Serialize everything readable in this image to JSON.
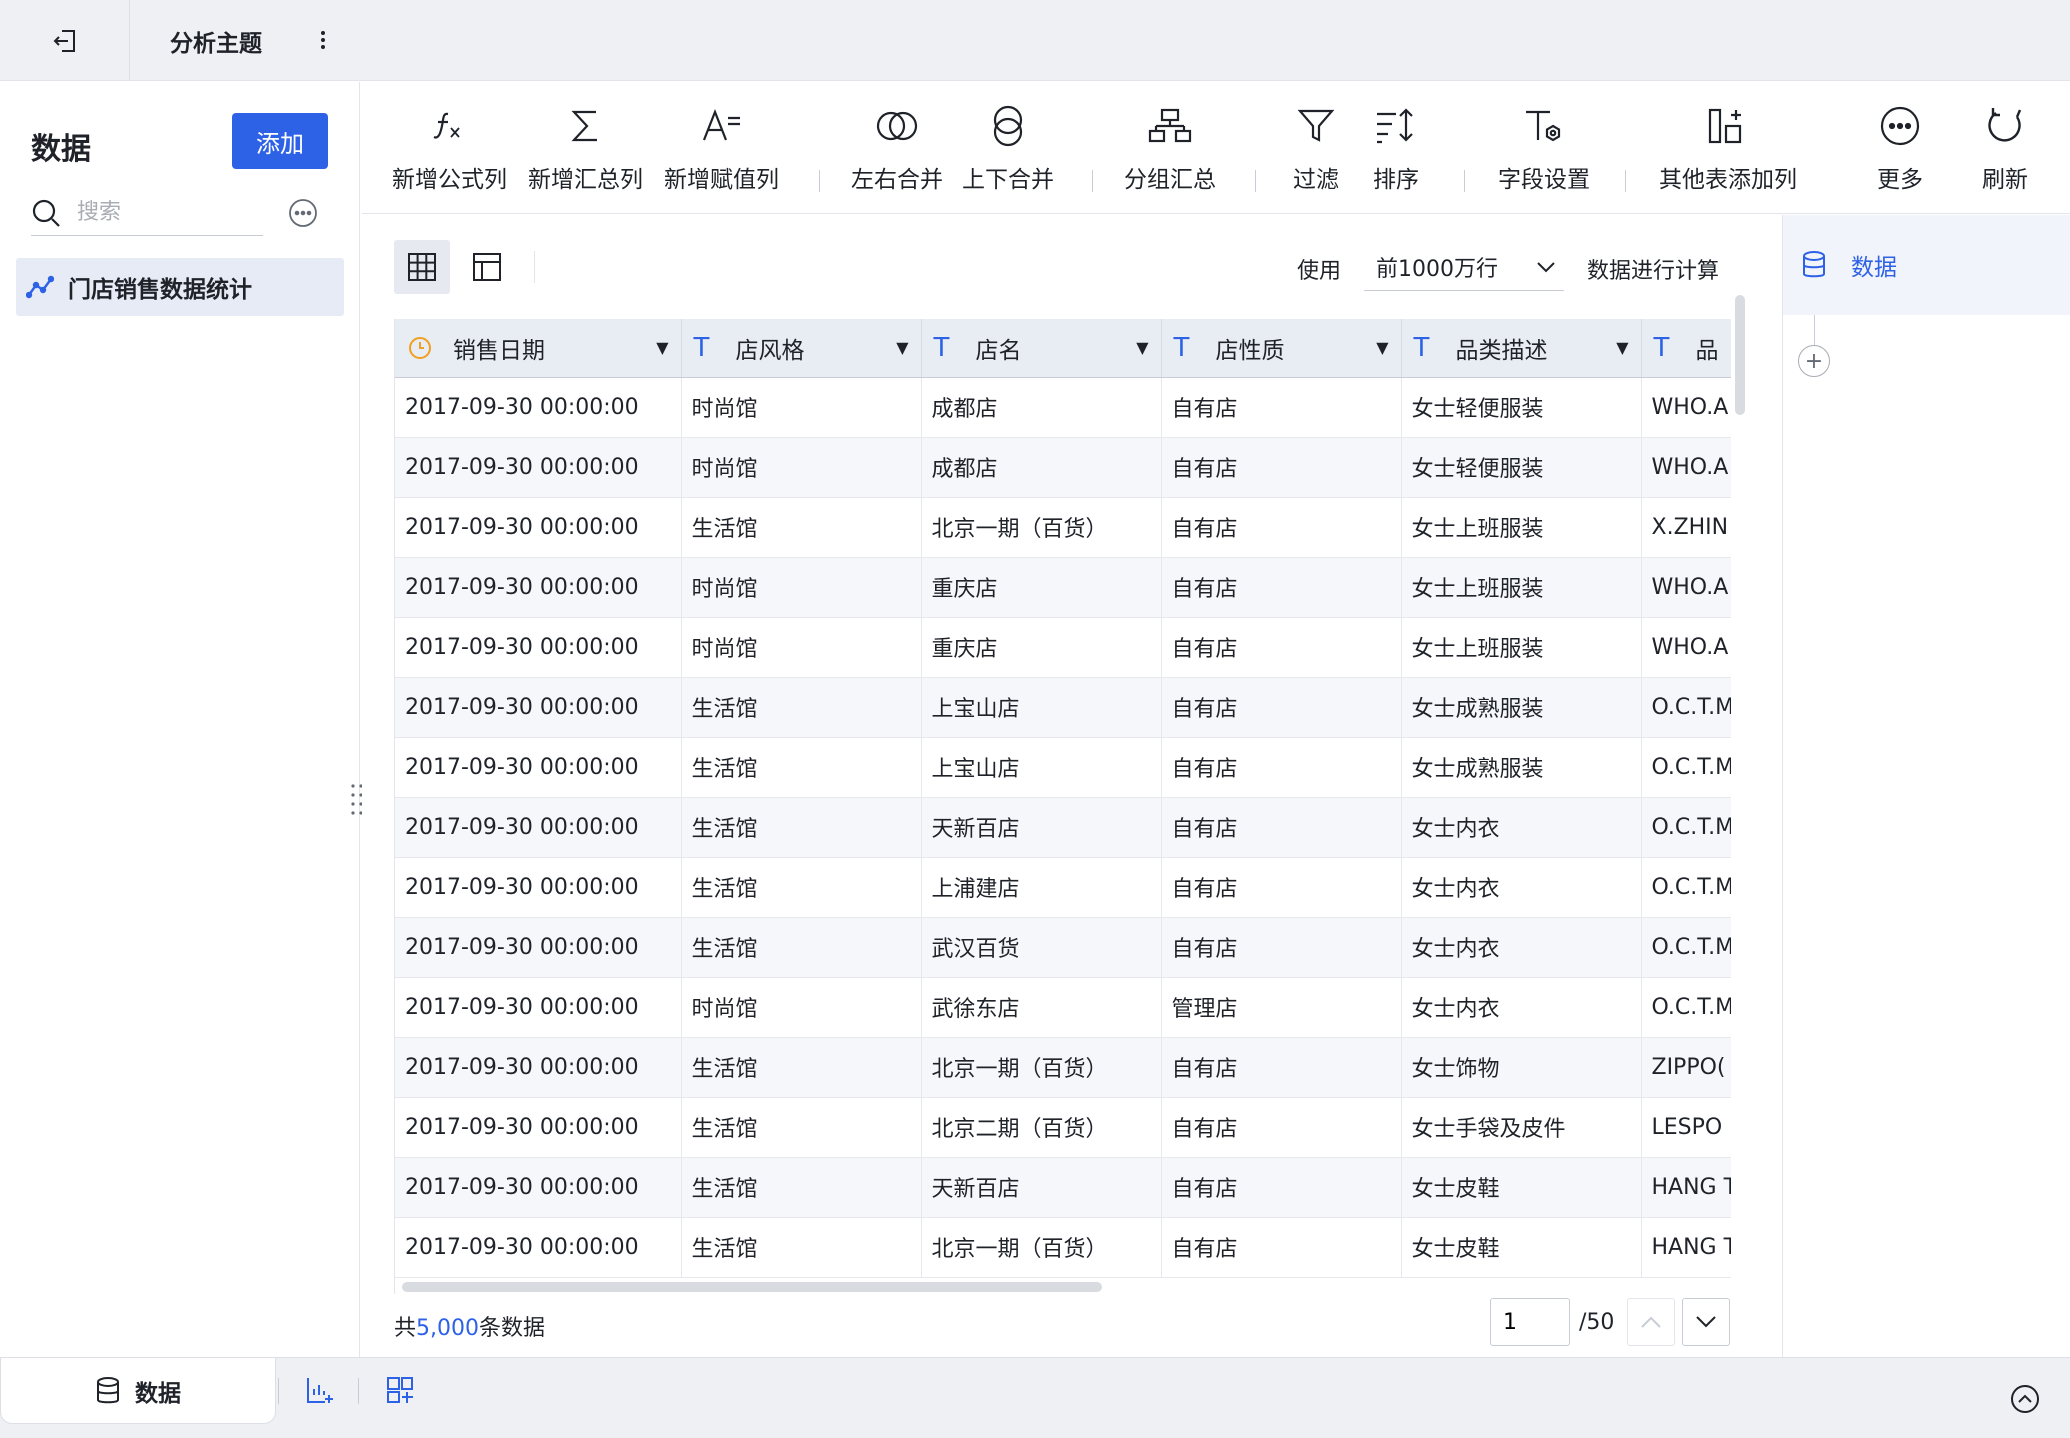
{
  "topbar": {
    "title": "分析主题"
  },
  "left": {
    "title": "数据",
    "add_label": "添加",
    "search_placeholder": "搜索",
    "items": [
      {
        "label": "门店销售数据统计"
      }
    ]
  },
  "toolbar": {
    "tools": [
      {
        "label": "新增公式列",
        "icon": "formula-icon"
      },
      {
        "label": "新增汇总列",
        "icon": "sigma-icon"
      },
      {
        "label": "新增赋值列",
        "icon": "assign-text-icon"
      },
      {
        "label": "左右合并",
        "icon": "merge-horizontal-icon"
      },
      {
        "label": "上下合并",
        "icon": "merge-vertical-icon"
      },
      {
        "label": "分组汇总",
        "icon": "group-summary-icon"
      },
      {
        "label": "过滤",
        "icon": "filter-icon"
      },
      {
        "label": "排序",
        "icon": "sort-icon"
      },
      {
        "label": "字段设置",
        "icon": "field-settings-icon"
      },
      {
        "label": "其他表添加列",
        "icon": "add-column-from-table-icon"
      },
      {
        "label": "更多",
        "icon": "more-icon"
      },
      {
        "label": "刷新",
        "icon": "refresh-icon"
      }
    ]
  },
  "content": {
    "use_label": "使用",
    "row_option": "前1000万行",
    "calc_label": "数据进行计算",
    "columns": [
      {
        "name": "销售日期",
        "type": "date"
      },
      {
        "name": "店风格",
        "type": "text"
      },
      {
        "name": "店名",
        "type": "text"
      },
      {
        "name": "店性质",
        "type": "text"
      },
      {
        "name": "品类描述",
        "type": "text"
      },
      {
        "name": "品",
        "type": "text"
      }
    ],
    "rows": [
      [
        "2017-09-30 00:00:00",
        "时尚馆",
        "成都店",
        "自有店",
        "女士轻便服装",
        "WHO.A"
      ],
      [
        "2017-09-30 00:00:00",
        "时尚馆",
        "成都店",
        "自有店",
        "女士轻便服装",
        "WHO.A"
      ],
      [
        "2017-09-30 00:00:00",
        "生活馆",
        "北京一期（百货）",
        "自有店",
        "女士上班服装",
        "X.ZHIN"
      ],
      [
        "2017-09-30 00:00:00",
        "时尚馆",
        "重庆店",
        "自有店",
        "女士上班服装",
        "WHO.A"
      ],
      [
        "2017-09-30 00:00:00",
        "时尚馆",
        "重庆店",
        "自有店",
        "女士上班服装",
        "WHO.A"
      ],
      [
        "2017-09-30 00:00:00",
        "生活馆",
        "上宝山店",
        "自有店",
        "女士成熟服装",
        "O.C.T.M"
      ],
      [
        "2017-09-30 00:00:00",
        "生活馆",
        "上宝山店",
        "自有店",
        "女士成熟服装",
        "O.C.T.M"
      ],
      [
        "2017-09-30 00:00:00",
        "生活馆",
        "天新百店",
        "自有店",
        "女士内衣",
        "O.C.T.M"
      ],
      [
        "2017-09-30 00:00:00",
        "生活馆",
        "上浦建店",
        "自有店",
        "女士内衣",
        "O.C.T.M"
      ],
      [
        "2017-09-30 00:00:00",
        "生活馆",
        "武汉百货",
        "自有店",
        "女士内衣",
        "O.C.T.M"
      ],
      [
        "2017-09-30 00:00:00",
        "时尚馆",
        "武徐东店",
        "管理店",
        "女士内衣",
        "O.C.T.M"
      ],
      [
        "2017-09-30 00:00:00",
        "生活馆",
        "北京一期（百货）",
        "自有店",
        "女士饰物",
        "ZIPPO("
      ],
      [
        "2017-09-30 00:00:00",
        "生活馆",
        "北京二期（百货）",
        "自有店",
        "女士手袋及皮件",
        "LESPO"
      ],
      [
        "2017-09-30 00:00:00",
        "生活馆",
        "天新百店",
        "自有店",
        "女士皮鞋",
        "HANG T"
      ],
      [
        "2017-09-30 00:00:00",
        "生活馆",
        "北京一期（百货）",
        "自有店",
        "女士皮鞋",
        "HANG T"
      ]
    ],
    "total_prefix": "共",
    "total_count": "5,000",
    "total_suffix": "条数据",
    "page_current": "1",
    "page_total": "/50"
  },
  "right": {
    "node_label": "数据"
  },
  "bottom": {
    "data_tab": "数据"
  },
  "colors": {
    "accent": "#2e62e6",
    "date_icon": "#f0a020"
  }
}
